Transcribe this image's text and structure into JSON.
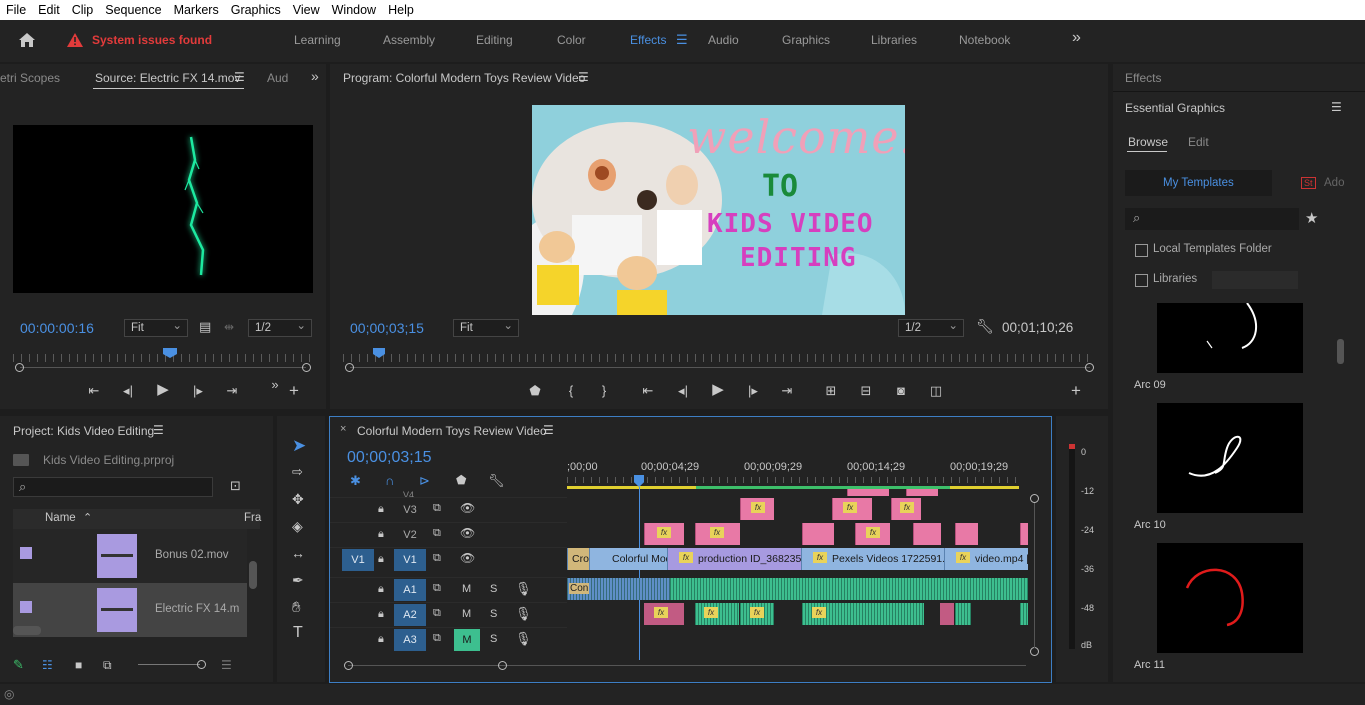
{
  "menu": [
    "File",
    "Edit",
    "Clip",
    "Sequence",
    "Markers",
    "Graphics",
    "View",
    "Window",
    "Help"
  ],
  "header": {
    "alert_text": "System issues found",
    "workspaces": [
      "Learning",
      "Assembly",
      "Editing",
      "Color",
      "Effects",
      "Audio",
      "Graphics",
      "Libraries",
      "Notebook"
    ],
    "active_workspace": "Effects",
    "more": "»"
  },
  "source_panel": {
    "tab_scopes": "etri Scopes",
    "tab_source": "Source: Electric FX 14.mov",
    "tab_audio": "Aud",
    "timecode": "00:00:00:16",
    "fit": "Fit",
    "resolution": "1/2"
  },
  "program_panel": {
    "title": "Program: Colorful Modern Toys Review Video",
    "timecode": "00;00;03;15",
    "fit": "Fit",
    "resolution": "1/2",
    "duration": "00;01;10;26",
    "frame_text": {
      "welcome": "welcome!",
      "to": "TO",
      "line1": "KIDS VIDEO",
      "line2": "EDITING"
    }
  },
  "project_panel": {
    "title": "Project: Kids Video Editing",
    "file": "Kids Video Editing.prproj",
    "col_name": "Name",
    "col_frame": "Fra",
    "items": [
      {
        "name": "Bonus 02.mov"
      },
      {
        "name": "Electric FX 14.m"
      }
    ]
  },
  "timeline": {
    "title": "Colorful Modern Toys Review Video",
    "timecode": "00;00;03;15",
    "ruler_labels": [
      ";00;00",
      "00;00;04;29",
      "00;00;09;29",
      "00;00;14;29",
      "00;00;19;29"
    ],
    "tracks": [
      {
        "id": "V4",
        "label": "V4"
      },
      {
        "id": "V3",
        "label": "V3"
      },
      {
        "id": "V2",
        "label": "V2"
      },
      {
        "id": "V1",
        "label": "V1",
        "source": "V1"
      },
      {
        "id": "A1",
        "label": "A1"
      },
      {
        "id": "A2",
        "label": "A2"
      },
      {
        "id": "A3",
        "label": "A3"
      }
    ],
    "v1_clips": [
      "Cro",
      "Colorful Mod",
      "production ID_3682356.",
      "Pexels Videos 1722591.mp",
      "video.mp4 [1"
    ],
    "a1_clip": "Con",
    "fx": "fx",
    "m": "M",
    "s": "S"
  },
  "meter": {
    "labels": [
      "0",
      "-12",
      "-24",
      "-36",
      "-48",
      "dB"
    ]
  },
  "effects_panel": {
    "title": "Effects",
    "subtitle": "Essential Graphics",
    "tab_browse": "Browse",
    "tab_edit": "Edit",
    "my_templates": "My Templates",
    "adobe_stock": "Ado",
    "st_badge": "St",
    "local_folder": "Local Templates Folder",
    "libraries": "Libraries",
    "templates": [
      {
        "name": "Arc 09"
      },
      {
        "name": "Arc 10"
      },
      {
        "name": "Arc 11"
      }
    ]
  },
  "colors": {
    "accent": "#4a90e2",
    "alert": "#e23b3b",
    "pink_clip": "#e879a6",
    "blue_clip": "#8fb5e0",
    "audio_clip": "#3dbf8f",
    "track_active": "#2d5f8f"
  }
}
